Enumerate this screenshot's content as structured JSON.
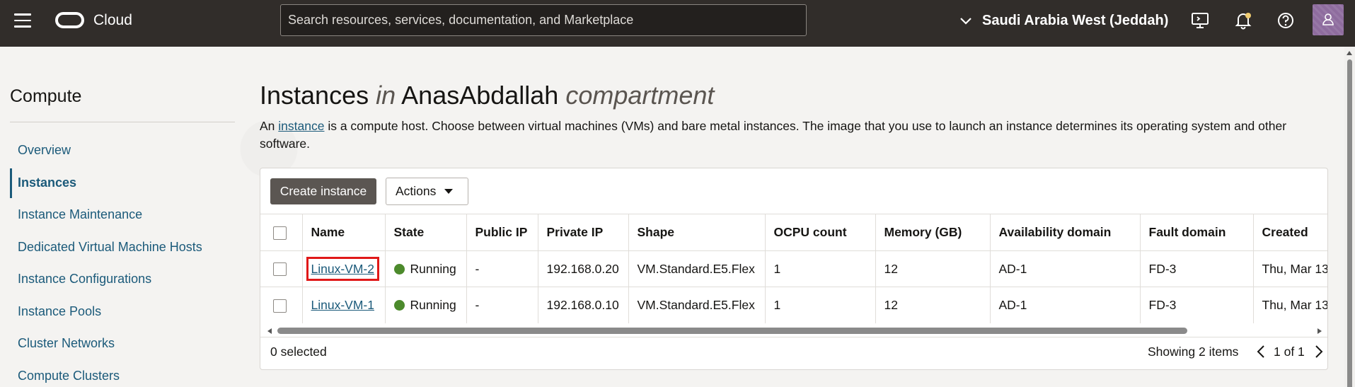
{
  "header": {
    "brand": "Cloud",
    "search_placeholder": "Search resources, services, documentation, and Marketplace",
    "region": "Saudi Arabia West (Jeddah)"
  },
  "sidebar": {
    "title": "Compute",
    "items": [
      {
        "label": "Overview"
      },
      {
        "label": "Instances"
      },
      {
        "label": "Instance Maintenance"
      },
      {
        "label": "Dedicated Virtual Machine Hosts"
      },
      {
        "label": "Instance Configurations"
      },
      {
        "label": "Instance Pools"
      },
      {
        "label": "Cluster Networks"
      },
      {
        "label": "Compute Clusters"
      }
    ]
  },
  "main": {
    "title_main": "Instances",
    "title_in": "in",
    "title_compartment": "AnasAbdallah",
    "title_suffix": "compartment",
    "desc_prefix": "An ",
    "desc_link": "instance",
    "desc_rest": " is a compute host. Choose between virtual machines (VMs) and bare metal instances. The image that you use to launch an instance determines its operating system and other software.",
    "create_button": "Create instance",
    "actions_button": "Actions",
    "columns": [
      "Name",
      "State",
      "Public IP",
      "Private IP",
      "Shape",
      "OCPU count",
      "Memory (GB)",
      "Availability domain",
      "Fault domain",
      "Created"
    ],
    "rows": [
      {
        "name": "Linux-VM-2",
        "state": "Running",
        "public_ip": "-",
        "private_ip": "192.168.0.20",
        "shape": "VM.Standard.E5.Flex",
        "ocpu": "1",
        "memory": "12",
        "ad": "AD-1",
        "fd": "FD-3",
        "created": "Thu, Mar 13"
      },
      {
        "name": "Linux-VM-1",
        "state": "Running",
        "public_ip": "-",
        "private_ip": "192.168.0.10",
        "shape": "VM.Standard.E5.Flex",
        "ocpu": "1",
        "memory": "12",
        "ad": "AD-1",
        "fd": "FD-3",
        "created": "Thu, Mar 13"
      }
    ],
    "selected_text": "0 selected",
    "showing_text": "Showing 2 items",
    "page_text": "1 of 1"
  },
  "colors": {
    "topbar": "#312d2a",
    "link": "#1b5a7a",
    "running": "#4c8a2c",
    "highlight": "#e01818"
  }
}
